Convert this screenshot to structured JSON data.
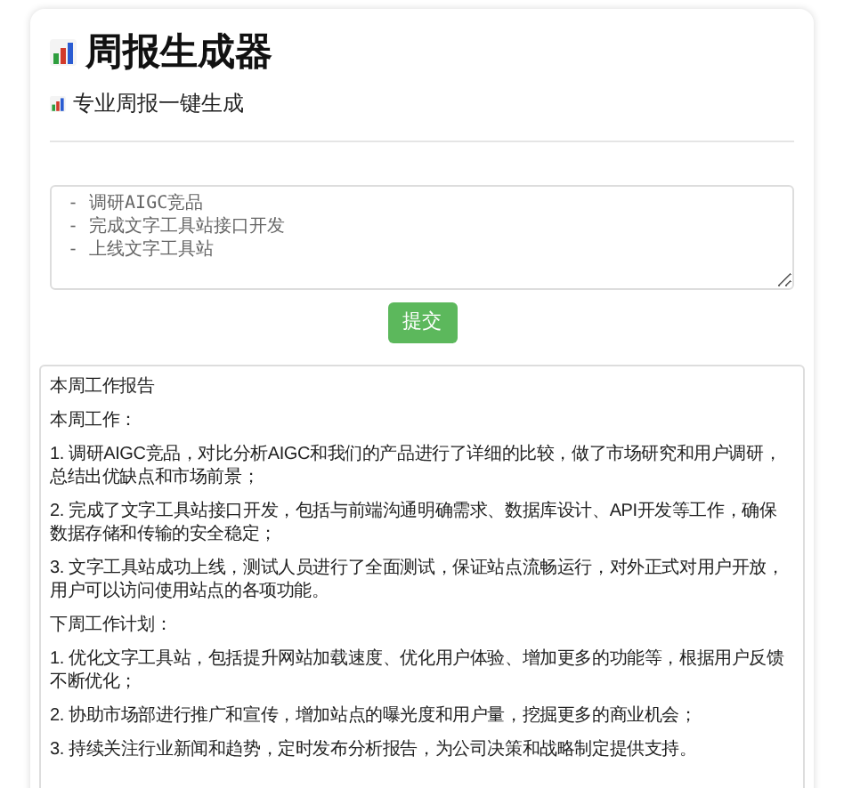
{
  "title": "周报生成器",
  "subtitle": "专业周报一键生成",
  "input": {
    "value": "- 调研AIGC竞品\n- 完成文字工具站接口开发\n- 上线文字工具站"
  },
  "submit_button": "提交",
  "report": [
    "本周工作报告",
    "本周工作：",
    "1. 调研AIGC竞品，对比分析AIGC和我们的产品进行了详细的比较，做了市场研究和用户调研，总结出优缺点和市场前景；",
    "2. 完成了文字工具站接口开发，包括与前端沟通明确需求、数据库设计、API开发等工作，确保数据存储和传输的安全稳定；",
    "3. 文字工具站成功上线，测试人员进行了全面测试，保证站点流畅运行，对外正式对用户开放，用户可以访问使用站点的各项功能。",
    "下周工作计划：",
    "1. 优化文字工具站，包括提升网站加载速度、优化用户体验、增加更多的功能等，根据用户反馈不断优化；",
    "2. 协助市场部进行推广和宣传，增加站点的曝光度和用户量，挖掘更多的商业机会；",
    "3. 持续关注行业新闻和趋势，定时发布分析报告，为公司决策和战略制定提供支持。"
  ]
}
